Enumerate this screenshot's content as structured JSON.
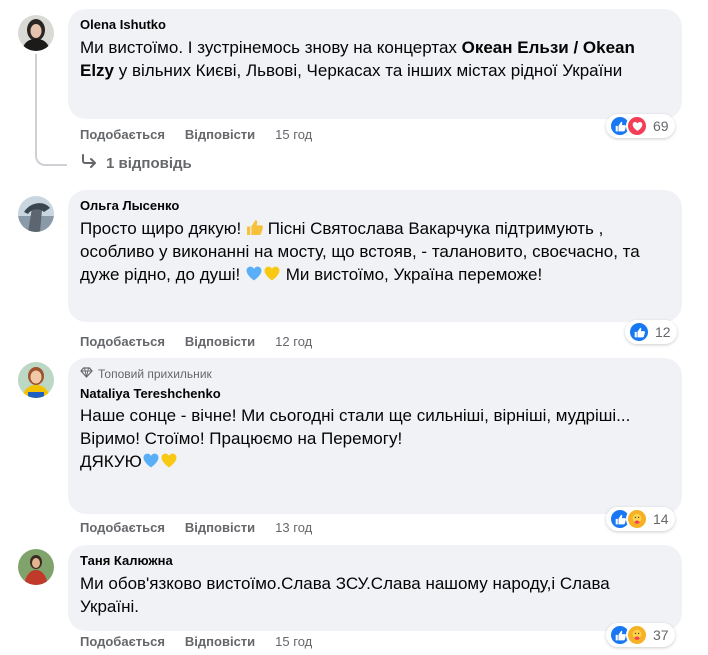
{
  "labels": {
    "like": "Подобається",
    "reply": "Відповісти"
  },
  "comments": [
    {
      "author": "Olena Ishutko",
      "text_a": "Ми вистоїмо. І зустрінемось знову на концертах ",
      "text_bold": "Океан Ельзи / Okean Elzy",
      "text_b": " у вільних Києві, Львові, Черкасах та інших містах рідної України",
      "time": "15 год",
      "reaction_count": "69",
      "reactions": [
        "like-icon",
        "love-icon"
      ],
      "replies_label": "1 відповідь"
    },
    {
      "author": "Ольга Лысенко",
      "text_a": "Просто щиро дякую! ",
      "text_b": " Пісні Святослава Вакарчука підтримують , особливо у виконанні на мосту, що встояв, - талановито, своєчасно, та дуже рідно, до душі! ",
      "text_c": " Ми вистоїмо, Україна переможе!",
      "time": "12 год",
      "reaction_count": "12",
      "reactions": [
        "like-icon"
      ]
    },
    {
      "badge": "Топовий прихильник",
      "author": "Nataliya Tereshchenko",
      "line1": "Наше сонце - вічне! Ми сьогодні стали ще сильніші, вірніші, мудріші...",
      "line2": "Віримо! Стоїмо! Працюємо на Перемогу!",
      "line3": "ДЯКУЮ",
      "time": "13 год",
      "reaction_count": "14",
      "reactions": [
        "like-icon",
        "care-icon"
      ]
    },
    {
      "author": "Таня Калюжна",
      "text": "Ми обов'язково вистоїмо.Слава ЗСУ.Слава нашому народу,і Слава Україні.",
      "time": "15 год",
      "reaction_count": "37",
      "reactions": [
        "like-icon",
        "care-icon"
      ]
    }
  ],
  "colors": {
    "like": "#1877f2",
    "love": "#f33e58",
    "care": "#f7b125",
    "bubble": "#f0f2f5",
    "muted": "#65676b"
  }
}
